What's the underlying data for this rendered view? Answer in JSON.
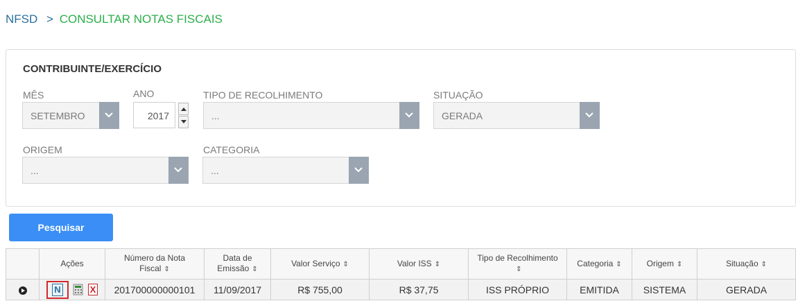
{
  "breadcrumb": {
    "root": "NFSD",
    "separator": ">",
    "current": "CONSULTAR NOTAS FISCAIS"
  },
  "panel": {
    "title": "CONTRIBUINTE/EXERCÍCIO",
    "mes": {
      "label": "MÊS",
      "value": "SETEMBRO"
    },
    "ano": {
      "label": "ANO",
      "value": "2017"
    },
    "tipo_recolhimento": {
      "label": "TIPO DE RECOLHIMENTO",
      "value": "..."
    },
    "situacao": {
      "label": "SITUAÇÃO",
      "value": "GERADA"
    },
    "origem": {
      "label": "ORIGEM",
      "value": "..."
    },
    "categoria": {
      "label": "CATEGORIA",
      "value": "..."
    }
  },
  "search_button": "Pesquisar",
  "table": {
    "headers": {
      "acoes": "Ações",
      "numero_line1": "Número da Nota",
      "numero_line2": "Fiscal",
      "data_line1": "Data de",
      "data_line2": "Emissão",
      "valor_servico": "Valor Serviço",
      "valor_iss": "Valor ISS",
      "tipo": "Tipo de Recolhimento",
      "categoria": "Categoria",
      "origem": "Origem",
      "situacao": "Situação"
    },
    "rows": [
      {
        "numero": "201700000000101",
        "data": "11/09/2017",
        "valor_servico": "R$ 755,00",
        "valor_iss": "R$ 37,75",
        "tipo": "ISS PRÓPRIO",
        "categoria": "EMITIDA",
        "origem": "SISTEMA",
        "situacao": "GERADA"
      }
    ]
  },
  "icons": {
    "row_toggle": "play-circle-icon",
    "nfs": "nfs-document-icon",
    "calculator": "calculator-icon",
    "cancel": "cancel-x-icon"
  }
}
